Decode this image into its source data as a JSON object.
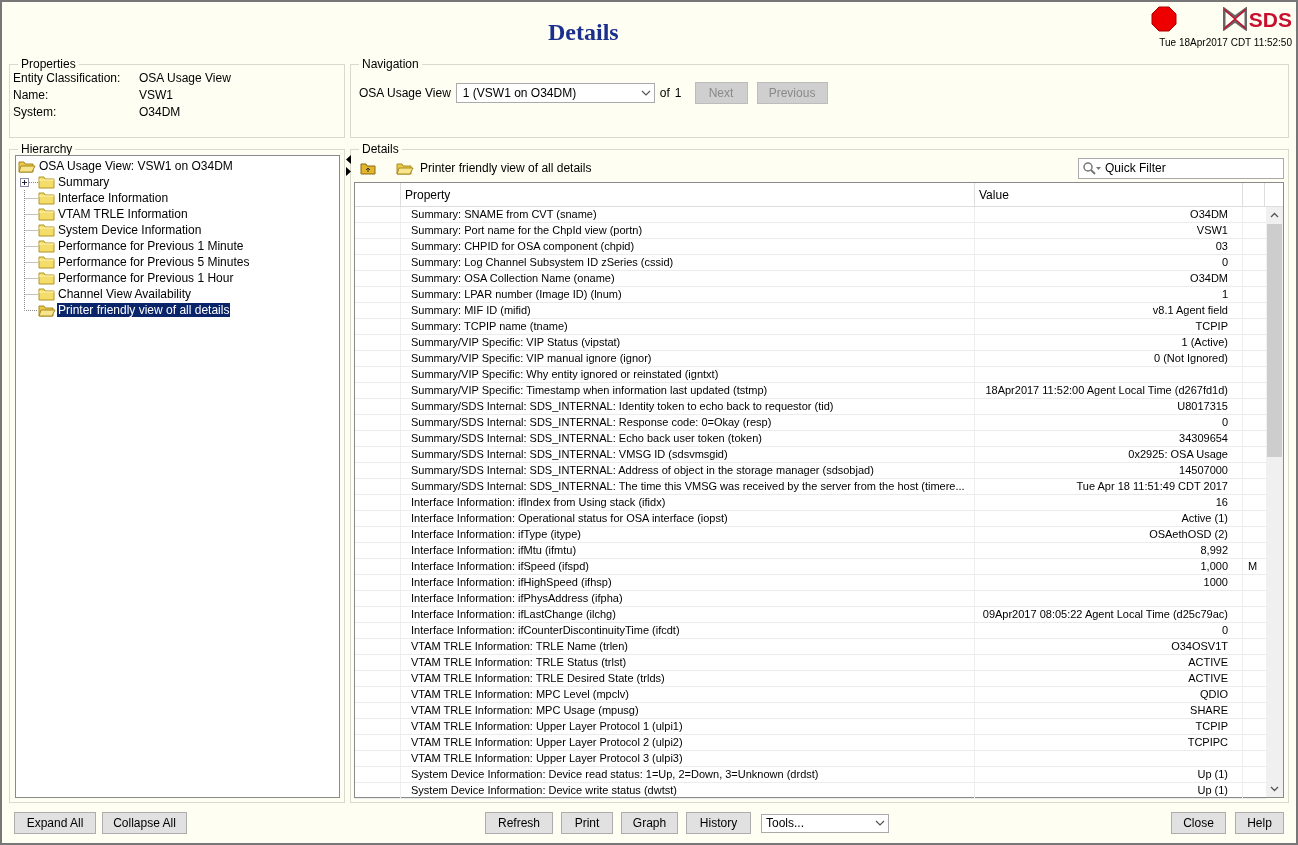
{
  "header": {
    "title": "Details",
    "logo_text": "SDS",
    "timestamp": "Tue 18Apr2017 CDT 11:52:50"
  },
  "properties": {
    "legend": "Properties",
    "fields": [
      {
        "label": "Entity Classification:",
        "value": "OSA Usage View"
      },
      {
        "label": "Name:",
        "value": "VSW1"
      },
      {
        "label": "System:",
        "value": "O34DM"
      }
    ]
  },
  "navigation": {
    "legend": "Navigation",
    "label": "OSA Usage View",
    "select_value": "1 (VSW1 on O34DM)",
    "of_text": "of",
    "count": "1",
    "buttons": [
      {
        "label": "Next",
        "disabled": true
      },
      {
        "label": "Previous",
        "disabled": true
      }
    ]
  },
  "hierarchy": {
    "legend": "Hierarchy",
    "root": {
      "label": "OSA Usage View: VSW1 on O34DM",
      "children": [
        {
          "label": "Summary",
          "collapsed": true,
          "selected": false
        },
        {
          "label": "Interface Information",
          "collapsed": false,
          "selected": false
        },
        {
          "label": "VTAM TRLE Information",
          "collapsed": false,
          "selected": false
        },
        {
          "label": "System Device Information",
          "collapsed": false,
          "selected": false
        },
        {
          "label": "Performance for Previous 1 Minute",
          "collapsed": false,
          "selected": false
        },
        {
          "label": "Performance for Previous 5 Minutes",
          "collapsed": false,
          "selected": false
        },
        {
          "label": "Performance for Previous 1 Hour",
          "collapsed": false,
          "selected": false
        },
        {
          "label": "Channel View Availability",
          "collapsed": false,
          "selected": false
        },
        {
          "label": "Printer friendly view of all details",
          "collapsed": false,
          "selected": true
        }
      ]
    }
  },
  "details": {
    "legend": "Details",
    "path_label": "Printer friendly view of all details",
    "filter": {
      "placeholder": "Quick Filter"
    },
    "columns": [
      "Property",
      "Value"
    ],
    "rows": [
      {
        "property": "Summary: SNAME from CVT (sname)",
        "value": "O34DM"
      },
      {
        "property": "Summary: Port name for the ChpId view (portn)",
        "value": "VSW1"
      },
      {
        "property": "Summary: CHPID for OSA component (chpid)",
        "value": "03"
      },
      {
        "property": "Summary: Log Channel Subsystem ID zSeries (cssid)",
        "value": "0"
      },
      {
        "property": "Summary: OSA Collection Name (oname)",
        "value": "O34DM"
      },
      {
        "property": "Summary: LPAR number (Image ID) (lnum)",
        "value": "1"
      },
      {
        "property": "Summary: MIF ID (mifid)",
        "value": "v8.1 Agent field"
      },
      {
        "property": "Summary: TCPIP name (tname)",
        "value": "TCPIP"
      },
      {
        "property": "Summary/VIP Specific: VIP Status (vipstat)",
        "value": "1 (Active)"
      },
      {
        "property": "Summary/VIP Specific: VIP manual ignore (ignor)",
        "value": "0 (Not Ignored)"
      },
      {
        "property": "Summary/VIP Specific: Why entity ignored or reinstated (igntxt)"
      },
      {
        "property": "Summary/VIP Specific: Timestamp when information last updated (tstmp)",
        "value": "18Apr2017 11:52:00 Agent Local Time (d267fd1d)"
      },
      {
        "property": "Summary/SDS Internal: SDS_INTERNAL: Identity token to echo back to requestor (tid)",
        "value": "U8017315"
      },
      {
        "property": "Summary/SDS Internal: SDS_INTERNAL: Response code: 0=Okay (resp)",
        "value": "0"
      },
      {
        "property": "Summary/SDS Internal: SDS_INTERNAL: Echo back user token (token)",
        "value": "34309654"
      },
      {
        "property": "Summary/SDS Internal: SDS_INTERNAL: VMSG ID (sdsvmsgid)",
        "value": "0x2925: OSA Usage"
      },
      {
        "property": "Summary/SDS Internal: SDS_INTERNAL: Address of object in the storage manager (sdsobjad)",
        "value": "14507000"
      },
      {
        "property": "Summary/SDS Internal: SDS_INTERNAL: The time this VMSG was received by the server from the host (timere...",
        "value": "Tue Apr 18 11:51:49 CDT 2017"
      },
      {
        "property": "Interface Information: ifIndex from Using stack (ifidx)",
        "value": "16"
      },
      {
        "property": "Interface Information: Operational status for OSA interface (iopst)",
        "value": "Active (1)"
      },
      {
        "property": "Interface Information: ifType (itype)",
        "value": "OSAethOSD (2)"
      },
      {
        "property": "Interface Information: ifMtu (ifmtu)",
        "value": "8,992"
      },
      {
        "property": "Interface Information: ifSpeed (ifspd)",
        "value": "1,000",
        "unit": "M"
      },
      {
        "property": "Interface Information: ifHighSpeed (ifhsp)",
        "value": "1000"
      },
      {
        "property": "Interface Information: ifPhysAddress (ifpha)"
      },
      {
        "property": "Interface Information: ifLastChange (ilchg)",
        "value": "09Apr2017 08:05:22 Agent Local Time (d25c79ac)"
      },
      {
        "property": "Interface Information: ifCounterDiscontinuityTime (ifcdt)",
        "value": "0"
      },
      {
        "property": "VTAM TRLE Information: TRLE Name (trlen)",
        "value": "O34OSV1T"
      },
      {
        "property": "VTAM TRLE Information: TRLE Status (trlst)",
        "value": "ACTIVE"
      },
      {
        "property": "VTAM TRLE Information: TRLE Desired State (trlds)",
        "value": "ACTIVE"
      },
      {
        "property": "VTAM TRLE Information: MPC Level (mpclv)",
        "value": "QDIO"
      },
      {
        "property": "VTAM TRLE Information: MPC Usage (mpusg)",
        "value": "SHARE"
      },
      {
        "property": "VTAM TRLE Information: Upper Layer Protocol 1 (ulpi1)",
        "value": "TCPIP"
      },
      {
        "property": "VTAM TRLE Information: Upper Layer Protocol 2 (ulpi2)",
        "value": "TCPIPC"
      },
      {
        "property": "VTAM TRLE Information: Upper Layer Protocol 3 (ulpi3)"
      },
      {
        "property": "System Device Information: Device read status: 1=Up, 2=Down, 3=Unknown (drdst)",
        "value": "Up (1)"
      },
      {
        "property": "System Device Information: Device write status (dwtst)",
        "value": "Up (1)"
      }
    ]
  },
  "footer": {
    "left_buttons": [
      "Expand All",
      "Collapse All"
    ],
    "center_buttons": [
      "Refresh",
      "Print",
      "Graph",
      "History"
    ],
    "tools_select": "Tools...",
    "right_buttons": [
      "Close",
      "Help"
    ]
  }
}
